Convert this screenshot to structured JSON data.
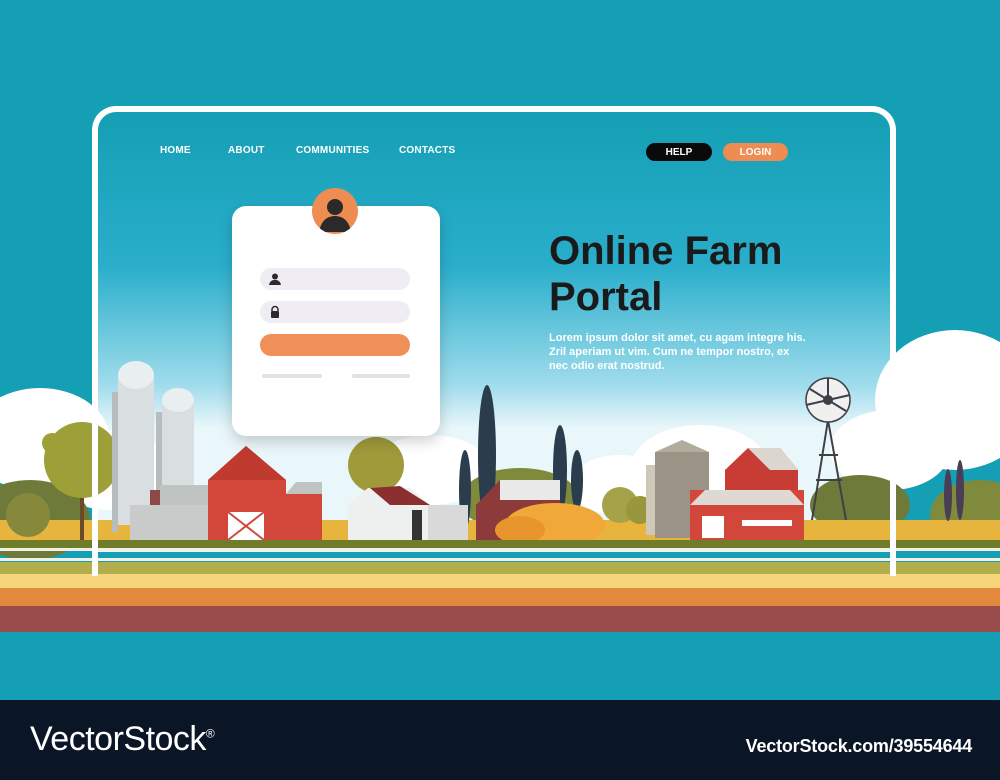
{
  "colors": {
    "sky_top": "#149fb4",
    "sky_bottom": "#f3fbfd",
    "accent_orange": "#ee8c52",
    "help_button": "#0a0a0a",
    "barn_red": "#d3463a",
    "footer": "#0a1626"
  },
  "nav": {
    "items": [
      "HOME",
      "ABOUT",
      "COMMUNITIES",
      "CONTACTS"
    ],
    "help_label": "HELP",
    "login_label": "LOGIN"
  },
  "login_card": {
    "avatar_icon": "user-icon",
    "username_icon": "user-icon",
    "password_icon": "lock-icon"
  },
  "hero": {
    "title": "Online Farm Portal",
    "text": "Lorem ipsum dolor sit amet, cu agam integre his. Zril aperiam ut vim. Cum ne tempor nostro, ex nec odio erat nostrud."
  },
  "watermark": {
    "brand": "VectorStock",
    "registered_mark": "®",
    "image_id": "VectorStock.com/39554644"
  }
}
